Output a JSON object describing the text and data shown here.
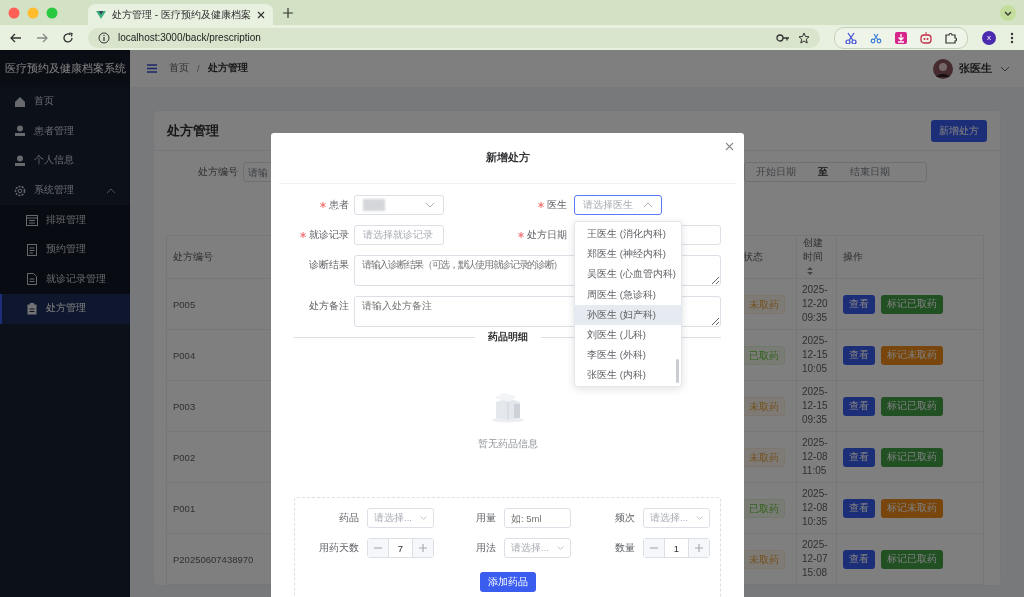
{
  "browser": {
    "tab_title": "处方管理 - 医疗预约及健康档案",
    "url": "localhost:3000/back/prescription",
    "profile": "x"
  },
  "sidebar": {
    "brand": "医疗预约及健康档案系统",
    "items": [
      {
        "label": "首页",
        "selected": false
      },
      {
        "label": "患者管理",
        "selected": false
      },
      {
        "label": "个人信息",
        "selected": false
      },
      {
        "label": "系统管理",
        "selected": false,
        "expanded": true,
        "children": [
          {
            "label": "排班管理",
            "selected": false
          },
          {
            "label": "预约管理",
            "selected": false
          },
          {
            "label": "就诊记录管理",
            "selected": false
          },
          {
            "label": "处方管理",
            "selected": true
          }
        ]
      }
    ]
  },
  "header": {
    "breadcrumb": [
      "首页",
      "处方管理"
    ],
    "breadcrumb_separator": "/",
    "user": "张医生"
  },
  "page": {
    "title": "处方管理",
    "add_button": "新增处方",
    "filter": {
      "label": "处方编号",
      "placeholder": "请输"
    },
    "date_range": {
      "start": "开始日期",
      "separator": "至",
      "end": "结束日期"
    },
    "table": {
      "columns": [
        {
          "label": "处方编号",
          "sortable": false
        },
        {
          "label": "状态",
          "sortable": false
        },
        {
          "label": "创建时间",
          "sortable": true
        },
        {
          "label": "操作",
          "sortable": false
        }
      ],
      "rows": [
        {
          "id": "P005",
          "status": {
            "text": "未取药",
            "kind": "pending"
          },
          "created": "2025-12-20 09:35",
          "actions": [
            {
              "label": "查看",
              "kind": "view"
            },
            {
              "label": "标记已取药",
              "kind": "mark-done"
            }
          ]
        },
        {
          "id": "P004",
          "status": {
            "text": "已取药",
            "kind": "done"
          },
          "created": "2025-12-15 10:05",
          "actions": [
            {
              "label": "查看",
              "kind": "view"
            },
            {
              "label": "标记未取药",
              "kind": "mark-pending"
            }
          ]
        },
        {
          "id": "P003",
          "status": {
            "text": "未取药",
            "kind": "pending"
          },
          "created": "2025-12-15 09:35",
          "actions": [
            {
              "label": "查看",
              "kind": "view"
            },
            {
              "label": "标记已取药",
              "kind": "mark-done"
            }
          ]
        },
        {
          "id": "P002",
          "status": {
            "text": "未取药",
            "kind": "pending"
          },
          "created": "2025-12-08 11:05",
          "actions": [
            {
              "label": "查看",
              "kind": "view"
            },
            {
              "label": "标记已取药",
              "kind": "mark-done"
            }
          ]
        },
        {
          "id": "P001",
          "status": {
            "text": "已取药",
            "kind": "done"
          },
          "created": "2025-12-08 10:35",
          "actions": [
            {
              "label": "查看",
              "kind": "view"
            },
            {
              "label": "标记未取药",
              "kind": "mark-pending"
            }
          ]
        },
        {
          "id": "P20250607438970",
          "status": {
            "text": "未取药",
            "kind": "pending"
          },
          "created": "2025-12-07 15:08",
          "actions": [
            {
              "label": "查看",
              "kind": "view"
            },
            {
              "label": "标记已取药",
              "kind": "mark-done"
            }
          ]
        }
      ]
    }
  },
  "dialog": {
    "title": "新增处方",
    "fields": [
      {
        "label": "患者",
        "required": true,
        "kind": "select",
        "redacted": true
      },
      {
        "label": "医生",
        "required": true,
        "kind": "select",
        "placeholder": "请选择医生",
        "focused": true,
        "options": [
          {
            "label": "王医生 (消化内科)",
            "hovered": false
          },
          {
            "label": "郑医生 (神经内科)",
            "hovered": false
          },
          {
            "label": "吴医生 (心血管内科)",
            "hovered": false
          },
          {
            "label": "周医生 (急诊科)",
            "hovered": false
          },
          {
            "label": "孙医生 (妇产科)",
            "hovered": true
          },
          {
            "label": "刘医生 (儿科)",
            "hovered": false
          },
          {
            "label": "李医生 (外科)",
            "hovered": false
          },
          {
            "label": "张医生 (内科)",
            "hovered": false
          }
        ]
      },
      {
        "label": "就诊记录",
        "required": true,
        "kind": "select",
        "placeholder": "请选择就诊记录"
      },
      {
        "label": "处方日期",
        "required": true,
        "kind": "date"
      },
      {
        "label": "诊断结果",
        "required": false,
        "kind": "textarea",
        "placeholder": "请输入诊断结果（可选，默认使用就诊记录的诊断）"
      },
      {
        "label": "处方备注",
        "required": false,
        "kind": "textarea",
        "placeholder": "请输入处方备注"
      }
    ],
    "section_title": "药品明细",
    "empty_text": "暂无药品信息",
    "medicine_fields": [
      {
        "label": "药品",
        "kind": "select",
        "placeholder": "请选择..."
      },
      {
        "label": "用量",
        "kind": "input",
        "placeholder": "如: 5ml"
      },
      {
        "label": "频次",
        "kind": "select",
        "placeholder": "请选择..."
      },
      {
        "label": "用药天数",
        "kind": "number",
        "value": "7"
      },
      {
        "label": "用法",
        "kind": "select",
        "placeholder": "请选择..."
      },
      {
        "label": "数量",
        "kind": "number",
        "value": "1"
      }
    ],
    "add_button": "添加药品"
  }
}
